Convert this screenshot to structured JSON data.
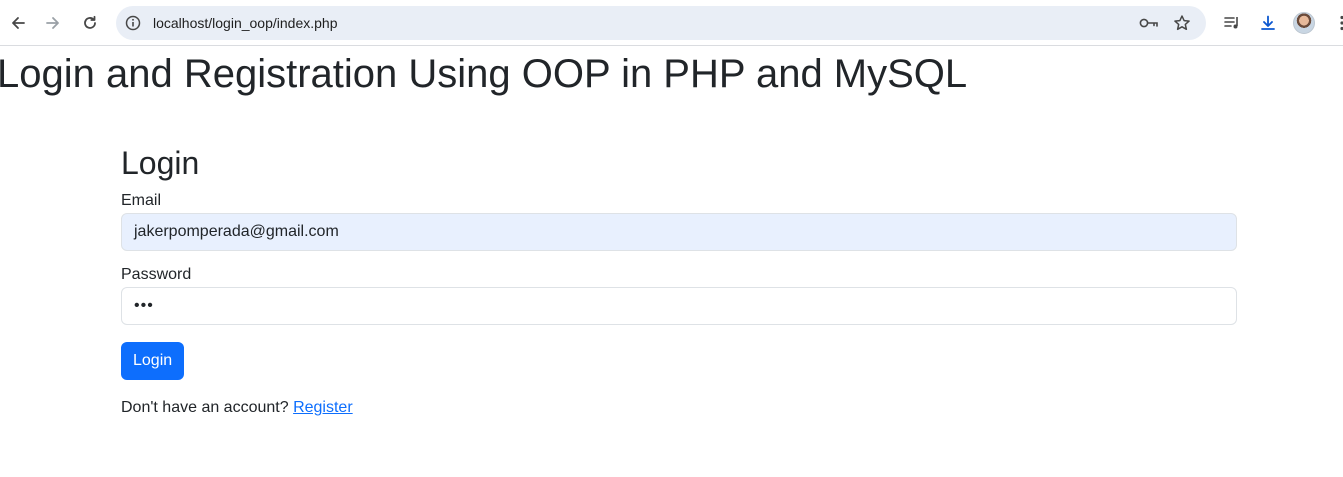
{
  "browser": {
    "url": "localhost/login_oop/index.php",
    "icons": [
      "back-icon",
      "forward-icon",
      "reload-icon",
      "site-info-icon",
      "password-key-icon",
      "bookmark-star-icon",
      "media-controls-icon",
      "download-icon",
      "profile-avatar",
      "menu-dots-icon"
    ]
  },
  "page": {
    "title": "Login and Registration Using OOP in PHP and MySQL"
  },
  "form": {
    "heading": "Login",
    "email_label": "Email",
    "email_value": "jakerpomperada@gmail.com",
    "password_label": "Password",
    "password_value": "•••",
    "submit_label": "Login",
    "register_prompt": "Don't have an account?",
    "register_link": "Register"
  },
  "colors": {
    "primary": "#0d6efd",
    "autofill_bg": "#e8f0fe",
    "omnibox_bg": "#e9eef6",
    "text": "#212529"
  }
}
